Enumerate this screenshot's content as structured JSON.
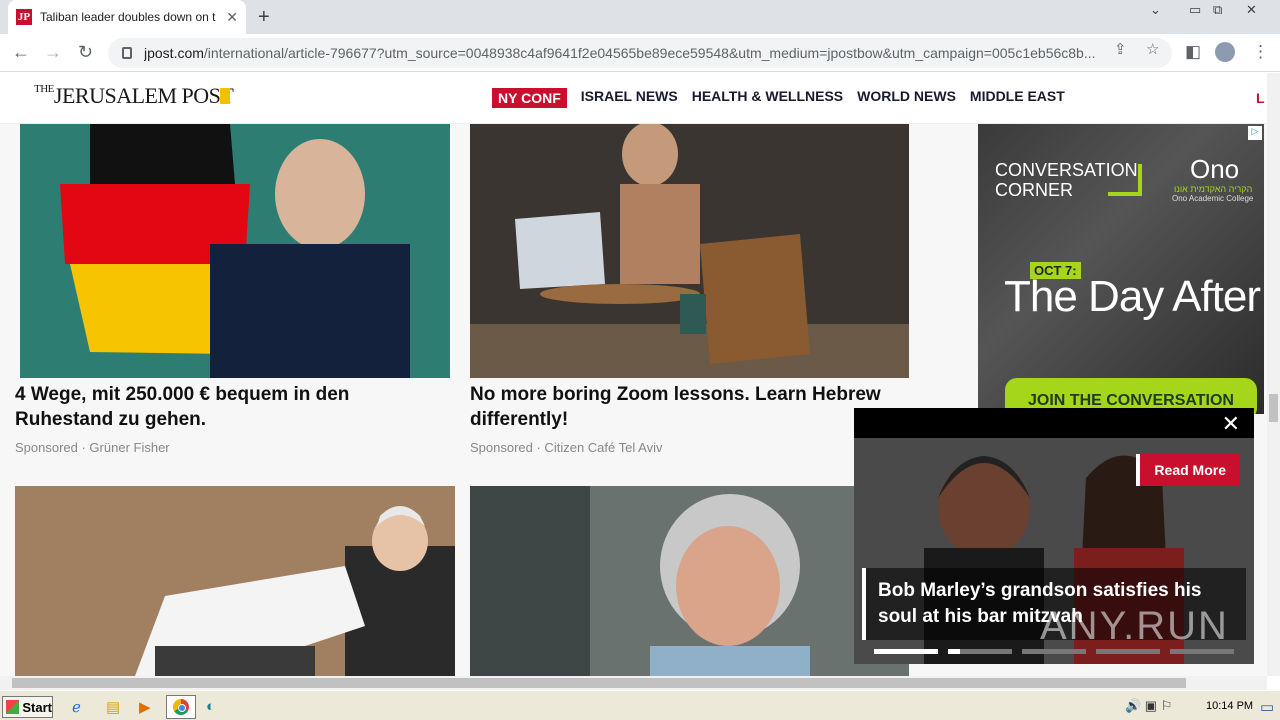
{
  "browser": {
    "tab_title": "Taliban leader doubles down on treat",
    "tab_favicon": "JP",
    "url_host": "jpost.com",
    "url_rest": "/international/article-796677?utm_source=0048938c4af9641f2e04565be89ece59548&utm_medium=jpostbow&utm_campaign=005c1eb56c8b..."
  },
  "site": {
    "logo_the": "THE",
    "logo_name": "JERUSALEM POST",
    "nav": [
      "NY CONF",
      "ISRAEL NEWS",
      "HEALTH & WELLNESS",
      "WORLD NEWS",
      "MIDDLE EAST"
    ],
    "nav_cut": "L"
  },
  "cards": [
    {
      "title": "4 Wege, mit 250.000 € bequem in den Ruhestand zu gehen.",
      "meta": "Sponsored · Grüner Fisher"
    },
    {
      "title": "No more boring Zoom lessons. Learn Hebrew differently!",
      "meta": "Sponsored · Citizen Café Tel Aviv"
    }
  ],
  "ad": {
    "line1": "CONVERSATION",
    "line2": "CORNER",
    "ono": "Ono",
    "hebrew": "הקריה האקדמית אונו",
    "college": "Ono Academic College",
    "oct": "OCT 7:",
    "headline": "The Day After",
    "cta": "JOIN THE CONVERSATION",
    "choice": "▷"
  },
  "video": {
    "read_more": "Read More",
    "caption": "Bob Marley’s grandson satisfies his soul at his bar mitzvah",
    "close": "✕"
  },
  "watermark": "ANY.RUN",
  "taskbar": {
    "start": "Start",
    "clock": "10:14 PM"
  }
}
